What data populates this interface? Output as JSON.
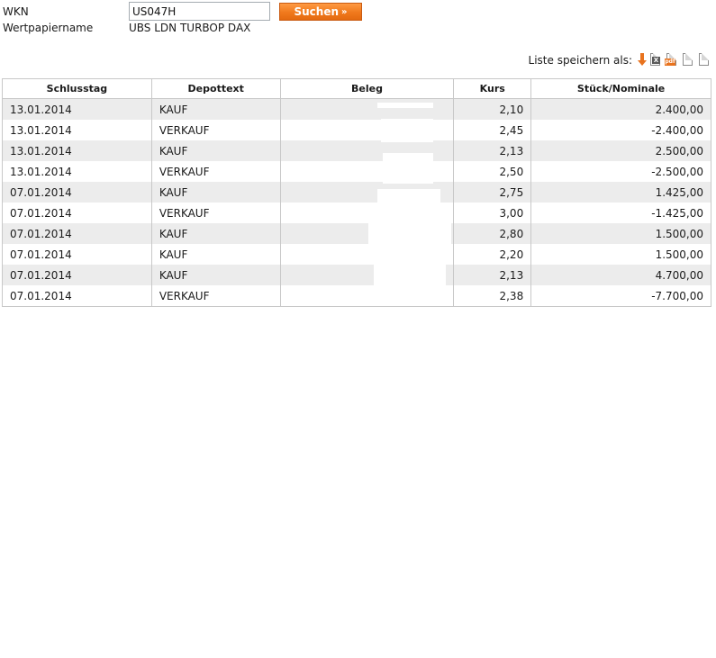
{
  "search": {
    "wkn_label": "WKN",
    "wkn_value": "US047H",
    "button_label": "Suchen",
    "button_chevron": "»",
    "name_label": "Wertpapiername",
    "name_value": "UBS LDN TURBOP DAX"
  },
  "save": {
    "label": "Liste speichern als:",
    "icons": [
      "download-arrow-icon",
      "excel-icon",
      "pdf-icon",
      "csv-file-icon",
      "txt-file-icon"
    ],
    "xls_text": "X",
    "pdf_text": "pdf"
  },
  "table": {
    "columns": [
      "Schlusstag",
      "Depottext",
      "Beleg",
      "Kurs",
      "Stück/Nominale"
    ],
    "rows": [
      {
        "date": "13.01.2014",
        "text": "KAUF",
        "beleg": "",
        "kurs": "2,10",
        "stueck": "2.400,00"
      },
      {
        "date": "13.01.2014",
        "text": "VERKAUF",
        "beleg": "",
        "kurs": "2,45",
        "stueck": "-2.400,00"
      },
      {
        "date": "13.01.2014",
        "text": "KAUF",
        "beleg": "",
        "kurs": "2,13",
        "stueck": "2.500,00"
      },
      {
        "date": "13.01.2014",
        "text": "VERKAUF",
        "beleg": "",
        "kurs": "2,50",
        "stueck": "-2.500,00"
      },
      {
        "date": "07.01.2014",
        "text": "KAUF",
        "beleg": "",
        "kurs": "2,75",
        "stueck": "1.425,00"
      },
      {
        "date": "07.01.2014",
        "text": "VERKAUF",
        "beleg": "",
        "kurs": "3,00",
        "stueck": "-1.425,00"
      },
      {
        "date": "07.01.2014",
        "text": "KAUF",
        "beleg": "",
        "kurs": "2,80",
        "stueck": "1.500,00"
      },
      {
        "date": "07.01.2014",
        "text": "KAUF",
        "beleg": "",
        "kurs": "2,20",
        "stueck": "1.500,00"
      },
      {
        "date": "07.01.2014",
        "text": "KAUF",
        "beleg": "",
        "kurs": "2,13",
        "stueck": "4.700,00"
      },
      {
        "date": "07.01.2014",
        "text": "VERKAUF",
        "beleg": "",
        "kurs": "2,38",
        "stueck": "-7.700,00"
      }
    ]
  },
  "colors": {
    "accent": "#f0791c",
    "row_stripe": "#ececec",
    "border": "#c8c8c8"
  }
}
